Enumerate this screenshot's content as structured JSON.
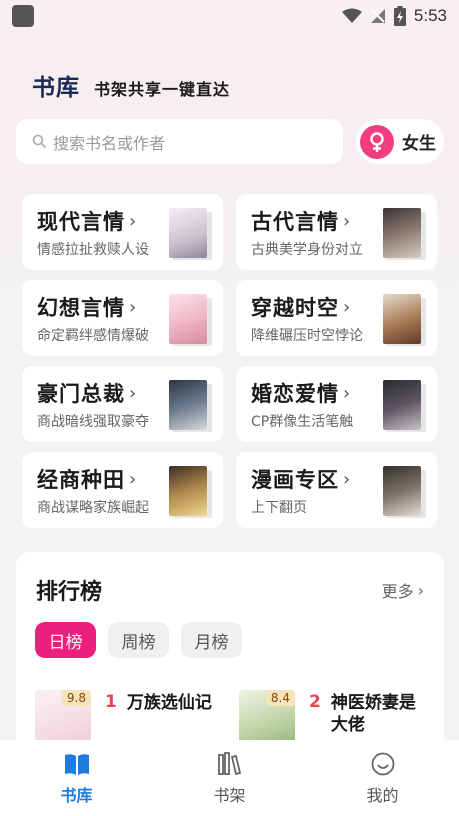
{
  "status_bar": {
    "time": "5:53"
  },
  "header": {
    "title": "书库",
    "slogan": "书架共享一键直达"
  },
  "search": {
    "placeholder": "搜索书名或作者",
    "icon": "search-icon"
  },
  "gender": {
    "label": "女生",
    "icon": "female-icon",
    "accent": "#f23e7e"
  },
  "categories": [
    {
      "title": "现代言情",
      "desc": "情感拉扯救赎人设"
    },
    {
      "title": "古代言情",
      "desc": "古典美学身份对立"
    },
    {
      "title": "幻想言情",
      "desc": "命定羁绊感情爆破"
    },
    {
      "title": "穿越时空",
      "desc": "降维碾压时空悖论"
    },
    {
      "title": "豪门总裁",
      "desc": "商战暗线强取豪夺"
    },
    {
      "title": "婚恋爱情",
      "desc": "CP群像生活笔触"
    },
    {
      "title": "经商种田",
      "desc": "商战谋略家族崛起"
    },
    {
      "title": "漫画专区",
      "desc": "上下翻页"
    }
  ],
  "ranking": {
    "title": "排行榜",
    "more": "更多",
    "tabs": [
      {
        "label": "日榜",
        "active": true
      },
      {
        "label": "周榜",
        "active": false
      },
      {
        "label": "月榜",
        "active": false
      }
    ],
    "items": [
      {
        "rank": "1",
        "name": "万族选仙记",
        "score": "9.8"
      },
      {
        "rank": "2",
        "name": "神医娇妻是大佬",
        "score": "8.4"
      }
    ]
  },
  "nav": [
    {
      "label": "书库",
      "icon": "library-book-icon",
      "active": true
    },
    {
      "label": "书架",
      "icon": "bookshelf-icon",
      "active": false
    },
    {
      "label": "我的",
      "icon": "smiley-profile-icon",
      "active": false
    }
  ],
  "colors": {
    "accent_pink": "#ee1e7d",
    "nav_active": "#1e7be0",
    "rank_number": "#e8454f"
  }
}
